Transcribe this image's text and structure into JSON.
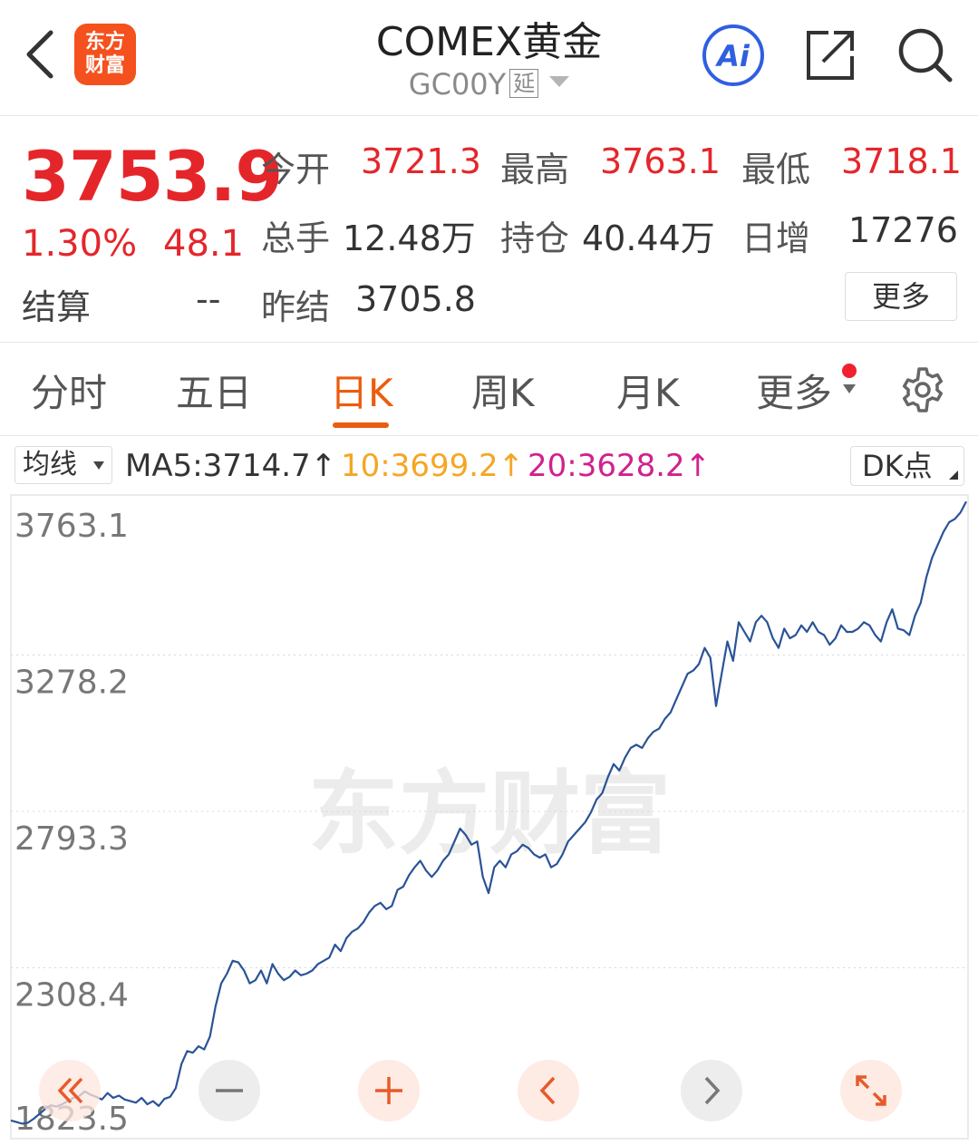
{
  "header": {
    "logo_line1": "东方",
    "logo_line2": "财富",
    "title": "COMEX黄金",
    "code": "GC00Y",
    "delay_badge": "延",
    "ai_label": "Ai"
  },
  "quote": {
    "price": "3753.9",
    "change_pct": "1.30%",
    "change": "48.1",
    "settle_label": "结算",
    "settle_value": "--",
    "open_label": "今开",
    "open_value": "3721.3",
    "high_label": "最高",
    "high_value": "3763.1",
    "low_label": "最低",
    "low_value": "3718.1",
    "volume_label": "总手",
    "volume_value": "12.48万",
    "position_label": "持仓",
    "position_value": "40.44万",
    "daily_inc_label": "日增",
    "daily_inc_value": "17276",
    "prev_settle_label": "昨结",
    "prev_settle_value": "3705.8",
    "more_label": "更多"
  },
  "tabs": [
    {
      "label": "分时"
    },
    {
      "label": "五日"
    },
    {
      "label": "日K"
    },
    {
      "label": "周K"
    },
    {
      "label": "月K"
    },
    {
      "label": "更多"
    }
  ],
  "ma_bar": {
    "select_label": "均线",
    "ma5": "MA5:3714.7↑",
    "ma10": "10:3699.2↑",
    "ma20": "20:3628.2↑",
    "dk_label": "DK点"
  },
  "colors": {
    "up_red": "#e4262b",
    "accent_orange": "#ec5c0e",
    "line_blue": "#2a5396",
    "ma10_yellow": "#f5a623",
    "ma20_magenta": "#d1218e"
  },
  "chart_data": {
    "type": "line",
    "y_tick_labels": [
      "3763.1",
      "3278.2",
      "2793.3",
      "2308.4",
      "1823.5"
    ],
    "y_ticks": [
      3763.1,
      3278.2,
      2793.3,
      2308.4,
      1823.5
    ],
    "ylim": [
      1823.5,
      3763.1
    ],
    "watermark": "东方财富",
    "series": [
      {
        "values": [
          1835,
          1830,
          1825,
          1828,
          1840,
          1855,
          1870,
          1882,
          1878,
          1885,
          1895,
          1905,
          1910,
          1925,
          1915,
          1908,
          1900,
          1920,
          1905,
          1912,
          1900,
          1895,
          1890,
          1905,
          1885,
          1895,
          1880,
          1902,
          1908,
          1935,
          2010,
          2050,
          2045,
          2065,
          2055,
          2095,
          2190,
          2260,
          2290,
          2330,
          2325,
          2300,
          2260,
          2270,
          2300,
          2260,
          2320,
          2290,
          2270,
          2280,
          2300,
          2285,
          2290,
          2300,
          2320,
          2330,
          2340,
          2380,
          2360,
          2400,
          2420,
          2430,
          2450,
          2480,
          2500,
          2510,
          2490,
          2500,
          2550,
          2560,
          2595,
          2620,
          2640,
          2610,
          2590,
          2610,
          2640,
          2660,
          2700,
          2740,
          2720,
          2690,
          2700,
          2590,
          2540,
          2620,
          2640,
          2620,
          2660,
          2670,
          2690,
          2680,
          2660,
          2650,
          2660,
          2620,
          2630,
          2660,
          2700,
          2720,
          2740,
          2760,
          2790,
          2830,
          2850,
          2900,
          2940,
          2920,
          2960,
          2990,
          3000,
          2990,
          3020,
          3040,
          3050,
          3080,
          3100,
          3140,
          3180,
          3220,
          3230,
          3250,
          3300,
          3270,
          3120,
          3220,
          3320,
          3260,
          3380,
          3350,
          3320,
          3380,
          3400,
          3380,
          3330,
          3300,
          3360,
          3330,
          3340,
          3370,
          3350,
          3380,
          3350,
          3340,
          3310,
          3330,
          3370,
          3350,
          3350,
          3360,
          3380,
          3370,
          3340,
          3320,
          3380,
          3420,
          3360,
          3355,
          3340,
          3400,
          3440,
          3520,
          3580,
          3620,
          3660,
          3690,
          3700,
          3720,
          3754
        ]
      }
    ]
  },
  "controls": [
    "fast-back",
    "zoom-out",
    "zoom-in",
    "prev",
    "next",
    "fullscreen"
  ]
}
